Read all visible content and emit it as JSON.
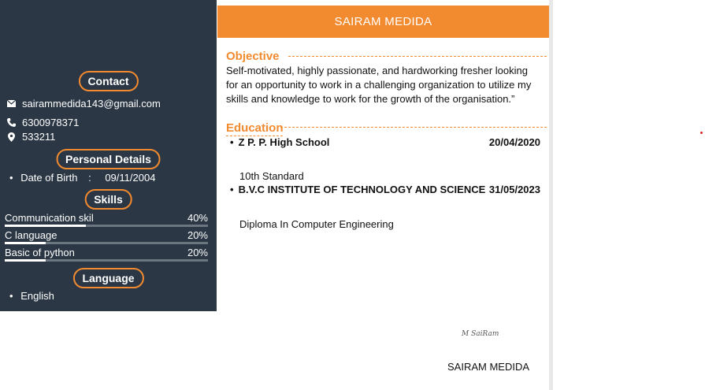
{
  "header": {
    "name": "SAIRAM MEDIDA"
  },
  "sidebar": {
    "contact_title": "Contact",
    "email": "sairammedida143@gmail.com",
    "phone": "6300978371",
    "pincode": "533211",
    "personal_title": "Personal Details",
    "dob_label": "Date of Birth",
    "dob_sep": ":",
    "dob_value": "09/11/2004",
    "skills_title": "Skills",
    "skills": [
      {
        "name": "Communication skil",
        "percent_label": "40%",
        "level": 0.4
      },
      {
        "name": "C language",
        "percent_label": "20%",
        "level": 0.2
      },
      {
        "name": "Basic of python",
        "percent_label": "20%",
        "level": 0.2
      }
    ],
    "language_title": "Language",
    "languages": [
      "English"
    ]
  },
  "objective": {
    "title": "Objective",
    "text": "Self-motivated, highly passionate, and hardworking fresher looking for an opportunity to work in a challenging organization to utilize my skills and knowledge to work for the growth of the organisation.”"
  },
  "education": {
    "title": "Education",
    "items": [
      {
        "school": "Z P. P. High School",
        "date": "20/04/2020",
        "detail": "10th Standard"
      },
      {
        "school": "B.V.C INSTITUTE OF TECHNOLOGY AND SCIENCE",
        "date": "31/05/2023",
        "detail": "Diploma In Computer Engineering"
      }
    ]
  },
  "signature": {
    "handwritten": "M SaiRam",
    "name": "SAIRAM MEDIDA"
  },
  "colors": {
    "accent": "#f28a30",
    "sidebar_bg": "#2b3744"
  },
  "icons": {
    "email": "envelope-icon",
    "phone": "phone-icon",
    "location": "location-pin-icon"
  }
}
